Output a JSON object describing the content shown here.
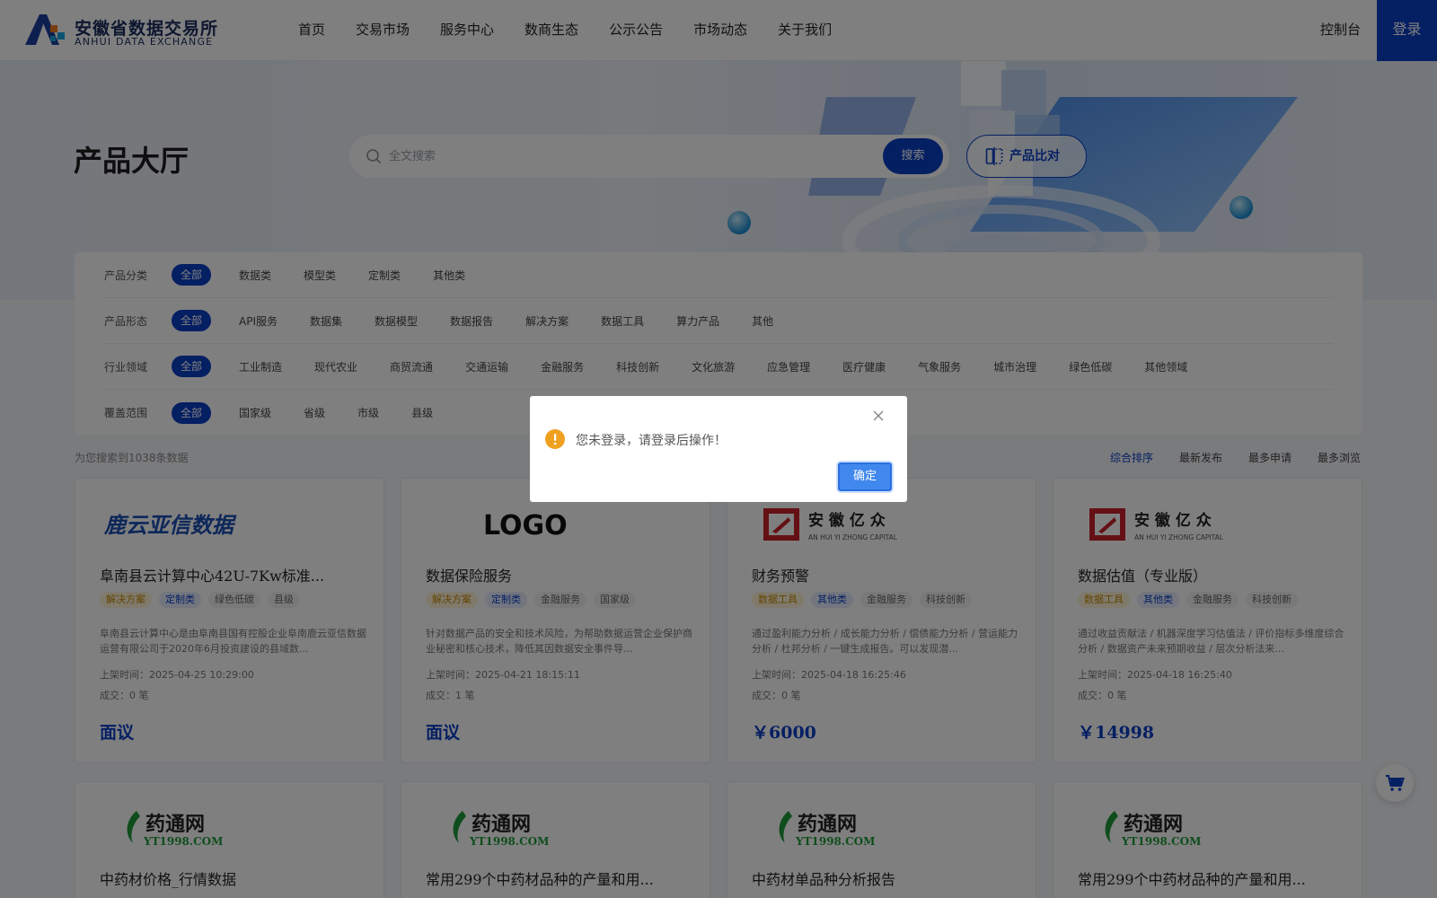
{
  "header": {
    "logo_cn": "安徽省数据交易所",
    "logo_en": "ANHUI DATA EXCHANGE",
    "nav": [
      "首页",
      "交易市场",
      "服务中心",
      "数商生态",
      "公示公告",
      "市场动态",
      "关于我们"
    ],
    "console": "控制台",
    "login": "登录"
  },
  "hero": {
    "title": "产品大厅",
    "search_placeholder": "全文搜索",
    "search_button": "搜索",
    "compare_button": "产品比对"
  },
  "filters": [
    {
      "label": "产品分类",
      "options": [
        "全部",
        "数据类",
        "模型类",
        "定制类",
        "其他类"
      ]
    },
    {
      "label": "产品形态",
      "options": [
        "全部",
        "API服务",
        "数据集",
        "数据模型",
        "数据报告",
        "解决方案",
        "数据工具",
        "算力产品",
        "其他"
      ]
    },
    {
      "label": "行业领域",
      "options": [
        "全部",
        "工业制造",
        "现代农业",
        "商贸流通",
        "交通运输",
        "金融服务",
        "科技创新",
        "文化旅游",
        "应急管理",
        "医疗健康",
        "气象服务",
        "城市治理",
        "绿色低碳",
        "其他领域"
      ]
    },
    {
      "label": "覆盖范围",
      "options": [
        "全部",
        "国家级",
        "省级",
        "市级",
        "县级"
      ]
    }
  ],
  "results": {
    "count_text": "为您搜索到1038条数据",
    "sort": [
      "综合排序",
      "最新发布",
      "最多申请",
      "最多浏览"
    ]
  },
  "cards": [
    {
      "logo_text": "鹿云亚信数据",
      "title": "阜南县云计算中心42U-7Kw标准...",
      "tags": [
        {
          "t": "解决方案",
          "c": "yellow"
        },
        {
          "t": "定制类",
          "c": "blue"
        },
        {
          "t": "绿色低碳",
          "c": "gray"
        },
        {
          "t": "县级",
          "c": "gray"
        }
      ],
      "desc": "阜南县云计算中心是由阜南县国有控股企业阜南鹿云亚信数据运营有限公司于2020年6月投资建设的县域数...",
      "time": "上架时间：2025-04-25 10:29:00",
      "deals": "成交：0 笔",
      "price": "面议"
    },
    {
      "logo_text": "LOGO",
      "title": "数据保险服务",
      "tags": [
        {
          "t": "解决方案",
          "c": "yellow"
        },
        {
          "t": "定制类",
          "c": "blue"
        },
        {
          "t": "金融服务",
          "c": "gray"
        },
        {
          "t": "国家级",
          "c": "gray"
        }
      ],
      "desc": "针对数据产品的安全和技术风险，为帮助数据运营企业保护商业秘密和核心技术，降低其因数据安全事件导...",
      "time": "上架时间：2025-04-21 18:15:11",
      "deals": "成交：1 笔",
      "price": "面议"
    },
    {
      "logo_text": "安 徽 亿 众",
      "logo_sub": "AN HUI YI ZHONG CAPITAL",
      "title": "财务预警",
      "tags": [
        {
          "t": "数据工具",
          "c": "yellow"
        },
        {
          "t": "其他类",
          "c": "blue"
        },
        {
          "t": "金融服务",
          "c": "gray"
        },
        {
          "t": "科技创新",
          "c": "gray"
        }
      ],
      "desc": "通过盈利能力分析 / 成长能力分析 / 偿债能力分析 / 营运能力分析 / 杜邦分析 / 一键生成报告。可以发现潜...",
      "time": "上架时间：2025-04-18 16:25:46",
      "deals": "成交：0 笔",
      "price": "￥6000"
    },
    {
      "logo_text": "安 徽 亿 众",
      "logo_sub": "AN HUI YI ZHONG CAPITAL",
      "title": "数据估值（专业版）",
      "tags": [
        {
          "t": "数据工具",
          "c": "yellow"
        },
        {
          "t": "其他类",
          "c": "blue"
        },
        {
          "t": "金融服务",
          "c": "gray"
        },
        {
          "t": "科技创新",
          "c": "gray"
        }
      ],
      "desc": "通过收益贡献法 / 机器深度学习估值法 / 评价指标多维度综合分析 / 数据资产未来预期收益 / 层次分析法来...",
      "time": "上架时间：2025-04-18 16:25:40",
      "deals": "成交：0 笔",
      "price": "￥14998"
    }
  ],
  "cards_row2": [
    {
      "logo_text": "药通网",
      "logo_sub": "YT1998.COM",
      "title": "中药材价格_行情数据"
    },
    {
      "logo_text": "药通网",
      "logo_sub": "YT1998.COM",
      "title": "常用299个中药材品种的产量和用..."
    },
    {
      "logo_text": "药通网",
      "logo_sub": "YT1998.COM",
      "title": "中药材单品种分析报告"
    },
    {
      "logo_text": "药通网",
      "logo_sub": "YT1998.COM",
      "title": "常用299个中药材品种的产量和用..."
    }
  ],
  "modal": {
    "message": "您未登录，请登录后操作！",
    "confirm": "确定"
  },
  "colors": {
    "brand": "#0a3fc7",
    "modal_button": "#4088ee",
    "warning": "#f0a020"
  }
}
